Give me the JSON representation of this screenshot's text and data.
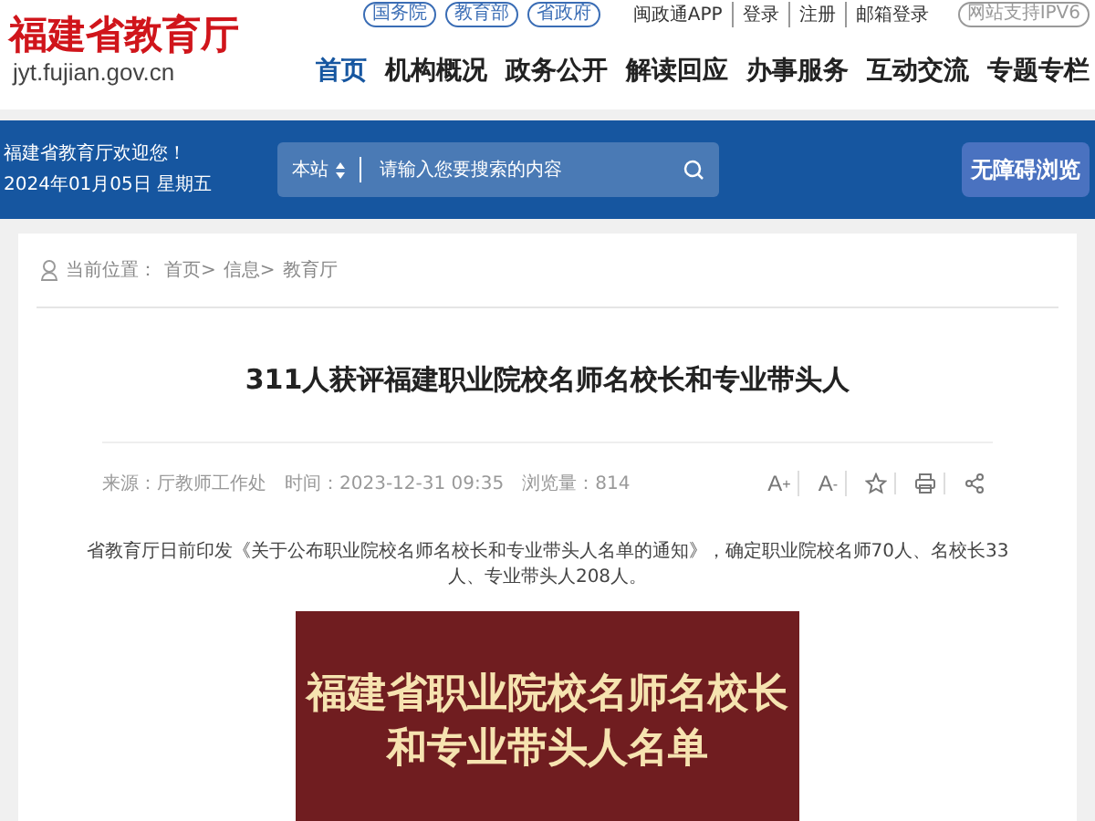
{
  "header": {
    "logo": "福建省教育厅",
    "domain": "jyt.fujian.gov.cn",
    "top_pills": [
      "国务院",
      "教育部",
      "省政府"
    ],
    "top_links": [
      "闽政通APP",
      "登录",
      "注册",
      "邮箱登录"
    ],
    "ipv6_badge": "网站支持IPV6",
    "nav": [
      {
        "label": "首页",
        "selected": true
      },
      {
        "label": "机构概况",
        "selected": false
      },
      {
        "label": "政务公开",
        "selected": false
      },
      {
        "label": "解读回应",
        "selected": false
      },
      {
        "label": "办事服务",
        "selected": false
      },
      {
        "label": "互动交流",
        "selected": false
      },
      {
        "label": "专题专栏",
        "selected": false
      }
    ]
  },
  "banner": {
    "welcome": "福建省教育厅欢迎您！",
    "date": "2024年01月05日 星期五",
    "search_scope": "本站",
    "search_placeholder": "请输入您要搜索的内容",
    "accessibility_button": "无障碍浏览"
  },
  "breadcrumb": {
    "label": "当前位置：",
    "items": [
      "首页>",
      "信息>",
      "教育厅"
    ]
  },
  "article": {
    "title": "311人获评福建职业院校名师名校长和专业带头人",
    "source": "来源：厅教师工作处",
    "time": "时间：2023-12-31 09:35",
    "views": "浏览量：814",
    "tools": [
      {
        "kind": "font-up",
        "label": "A",
        "sign": "+"
      },
      {
        "kind": "font-down",
        "label": "A",
        "sign": "-"
      },
      {
        "kind": "star"
      },
      {
        "kind": "print"
      },
      {
        "kind": "share"
      }
    ],
    "body": "省教育厅日前印发《关于公布职业院校名师名校长和专业带头人名单的通知》，确定职业院校名师70人、名校长33人、专业带头人208人。",
    "poster_lines": [
      "福建省职业院校名师名校长",
      "和专业带头人名单"
    ]
  }
}
